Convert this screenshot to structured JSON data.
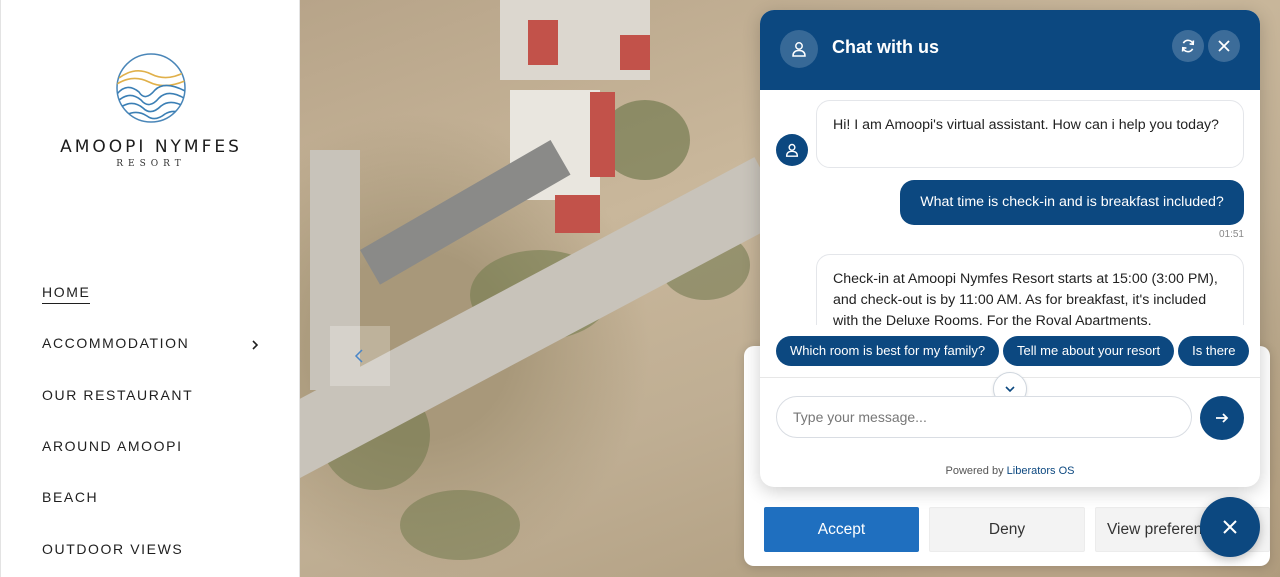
{
  "brand": {
    "name": "AMOOPI NYMFES",
    "sub": "RESORT",
    "logo_icon": "wave-sun-logo"
  },
  "nav": {
    "items": [
      {
        "label": "HOME",
        "active": true
      },
      {
        "label": "ACCOMMODATION",
        "has_submenu": true
      },
      {
        "label": "OUR RESTAURANT"
      },
      {
        "label": "AROUND AMOOPI"
      },
      {
        "label": "BEACH"
      },
      {
        "label": "OUTDOOR VIEWS"
      }
    ]
  },
  "slider": {
    "prev_icon": "chevron-left-icon"
  },
  "chat": {
    "title": "Chat with us",
    "header_icons": [
      "user-icon",
      "refresh-icon",
      "close-icon"
    ],
    "messages": [
      {
        "from": "bot",
        "text": "Hi! I am Amoopi's virtual assistant. How can i help you today?"
      },
      {
        "from": "user",
        "text": "What time is check-in and is breakfast included?",
        "time": "01:51"
      },
      {
        "from": "bot",
        "text": "Check-in at Amoopi Nymfes Resort starts at 15:00 (3:00 PM), and check-out is by 11:00 AM. As for breakfast, it's included with the Deluxe Rooms. For the Royal Apartments,"
      }
    ],
    "suggestions": [
      "Which room is best for my family?",
      "Tell me about your resort",
      "Is there"
    ],
    "input_placeholder": "Type your message...",
    "powered_prefix": "Powered by ",
    "powered_brand": "Liberators OS"
  },
  "cookie": {
    "accept": "Accept",
    "deny": "Deny",
    "preferences": "View preferences"
  },
  "colors": {
    "chat_primary": "#0c4880",
    "accept_button": "#1f6fbf"
  }
}
